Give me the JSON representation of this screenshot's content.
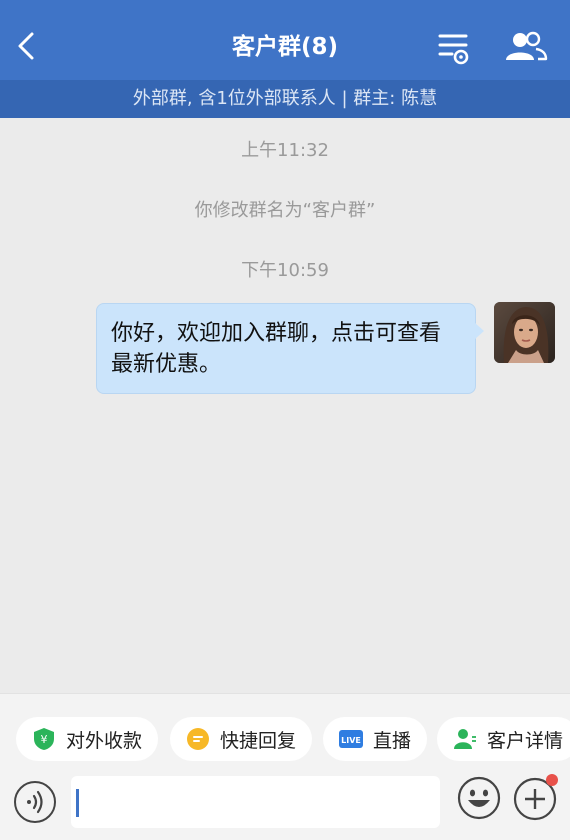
{
  "header": {
    "title": "客户群(8)",
    "subtitle": "外部群, 含1位外部联系人 | 群主: 陈慧"
  },
  "messages": {
    "time1": "上午11:32",
    "system": "你修改群名为“客户群”",
    "time2": "下午10:59",
    "bubble_text": "你好，欢迎加入群聊，点击可查看最新优惠。"
  },
  "quick_actions": [
    {
      "label": "对外收款",
      "icon": "payment-shield-icon"
    },
    {
      "label": "快捷回复",
      "icon": "quick-reply-icon"
    },
    {
      "label": "直播",
      "icon": "live-icon"
    },
    {
      "label": "客户详情",
      "icon": "customer-detail-icon"
    }
  ],
  "input": {
    "placeholder": ""
  },
  "colors": {
    "header": "#3f74c7",
    "subheader": "#3566b3",
    "bubble": "#cbe4fb",
    "badge": "#e8514a"
  }
}
